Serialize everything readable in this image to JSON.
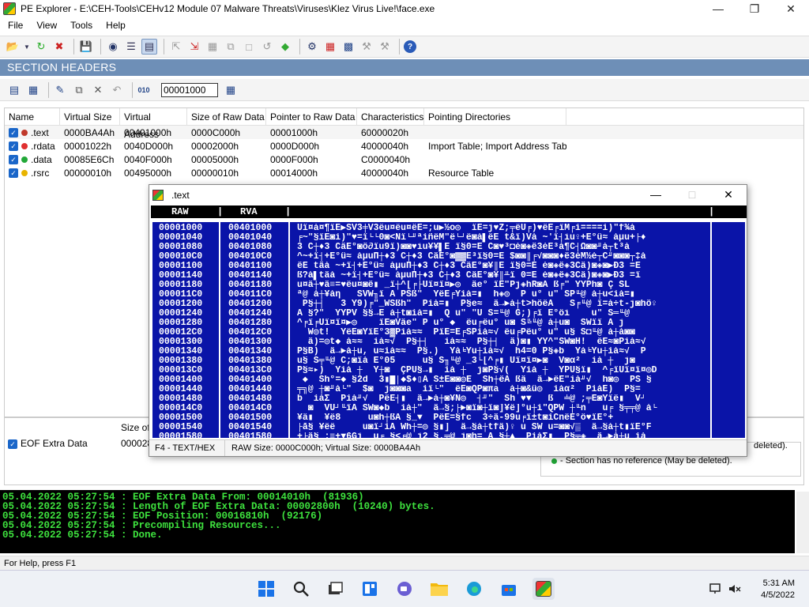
{
  "window": {
    "title": "PE Explorer - E:\\CEH-Tools\\CEHv12 Module 07 Malware Threats\\Viruses\\Klez Virus Live!\\face.exe"
  },
  "menu": [
    "File",
    "View",
    "Tools",
    "Help"
  ],
  "section_title": "SECTION HEADERS",
  "address_input": "00001000",
  "table": {
    "headers": [
      "Name",
      "Virtual Size",
      "Virtual Address",
      "Size of Raw Data",
      "Pointer to Raw Data",
      "Characteristics",
      "Pointing Directories"
    ],
    "rows": [
      {
        "name": ".text",
        "dot": "#c0392b",
        "vsize": "0000BA4Ah",
        "vaddr": "00401000h",
        "rawsize": "0000C000h",
        "rawptr": "00001000h",
        "chars": "60000020h",
        "dirs": ""
      },
      {
        "name": ".rdata",
        "dot": "#e03030",
        "vsize": "00001022h",
        "vaddr": "0040D000h",
        "rawsize": "00002000h",
        "rawptr": "0000D000h",
        "chars": "40000040h",
        "dirs": "Import Table; Import Address Table"
      },
      {
        "name": ".data",
        "dot": "#22a838",
        "vsize": "00085E6Ch",
        "vaddr": "0040F000h",
        "rawsize": "00005000h",
        "rawptr": "0000F000h",
        "chars": "C0000040h",
        "dirs": ""
      },
      {
        "name": ".rsrc",
        "dot": "#e8b400",
        "vsize": "00000010h",
        "vaddr": "00495000h",
        "rawsize": "00000010h",
        "rawptr": "00014000h",
        "chars": "40000040h",
        "dirs": "Resource Table"
      }
    ]
  },
  "eof": {
    "label": "EOF Extra Data",
    "size_header": "Size of",
    "size_value": "000028",
    "note_deleted": "deleted).",
    "note_no_ref": "- Section has no reference (May be deleted)."
  },
  "log": [
    "05.04.2022 05:27:54 : EOF Extra Data From: 00014010h  (81936)",
    "05.04.2022 05:27:54 : Length of EOF Extra Data: 00002800h  (10240) bytes.",
    "05.04.2022 05:27:54 : EOF Position: 00016810h  (92176)",
    "05.04.2022 05:27:54 : Precompiling Resources...",
    "05.04.2022 05:27:54 : Done."
  ],
  "status": "For Help, press F1",
  "hex_window": {
    "title": ".text",
    "col_raw": "RAW",
    "col_rva": "RVA",
    "status_mode": "F4 - TEXT/HEX",
    "status_info": "RAW Size: 0000C000h;  Virtual Size: 0000BA4Ah",
    "rows": [
      {
        "raw": "00001000",
        "rva": "00401000",
        "txt": "Uï¤à¤¶ïE▶SV3╪V3ëu¤ëu¤ëE=;u▶½o◎  ïE=j♥Z;╤ëU╒)♥ëE╒ïM╒ì====ì)\"f¾à"
      },
      {
        "raw": "00001040",
        "rva": "00401040",
        "txt": "╒~\"§ïE◙ì)\"♥=ï└└0◙<Ñï└╜ªìñëM\"ë└┘ë◙à▌ëE t&ï)Vá ~'ï┤iu♀+E°ü≈ àµu+├♦"
      },
      {
        "raw": "00001080",
        "rva": "00401080",
        "txt": "3 C┼♦3 CâE°◙ô∂ïu9ï)◙◙♥iu¥¥▌E ï§0=E C◙♥³◘è◙◈ê3èE³à¶C┤Ω◙◙╜à┬t³à"
      },
      {
        "raw": "000010C0",
        "rva": "004010C0",
        "txt": "^~+ï┤+E°ü≈ àµuΠ┼♦3 C┼♦3 CâE°◙▓▓E³ï§0=E $◙◙║╒√◙◙◙♦ê3èM½è┬C╜◙◙◙┬‡à"
      },
      {
        "raw": "00001100",
        "rva": "00401100",
        "txt": "êE tâà ~+ï┤+E°ü≈ àµuΠ┼♦3 C┼♦3 CâE°◙¥║E ï§0=E è◙◈ê◈3Câ)◙◈◙▶Đ3 =E"
      },
      {
        "raw": "00001140",
        "rva": "00401140",
        "txt": "ß?à▌tâà ~+ï┤+E°ü≈ àµuΠ┼♦3 C┼♦3 CâE°◙¥║╨ï 0=E è◙◈ê◈3Câ)◙◈◙▶Đ3 =ï"
      },
      {
        "raw": "00001180",
        "rva": "00401180",
        "txt": "u¤â┼♥â≡=♥ëu¤◙ê▮ _ï┼^[╒├Uï¤ï¤▶◎  âe° ïE\"Pj◈hR◙A ß╒\" YYPh◙ Ç SL"
      },
      {
        "raw": "000011C0",
        "rva": "004011C0",
        "txt": "ª@ à┼¥àη   SVW╖ï A PSß\"  YëE╒Yìà=▮  h◈◎  P u° u\" SP╙@ à┼u<ìà=▮"
      },
      {
        "raw": "00001200",
        "rva": "00401200",
        "txt": " P§┼┤   3 Y9)╒\"_WSßh\"  Pìà=▮  P§e≈  â→►à┼t>hôëΑ   S╒╙@ ï=à÷t-j◙hô♀"
      },
      {
        "raw": "00001240",
        "rva": "00401240",
        "txt": "A §?\"  YYPV §§→E à┼t◙ìà=▮  Q u\" \"U S=╙@ G;)╒ï E°öi    u\" S═╙@"
      },
      {
        "raw": "00001280",
        "rva": "00401280",
        "txt": "^╒ï╒Uï¤ï¤▶◎    ïE◙Vâe\" P u° ◆  ëu╒ëu° u◙ S╚╙@ à┼u◙  SWïï A j"
      },
      {
        "raw": "000012C0",
        "rva": "004012C0",
        "txt": "  W◎t!  YëE◙YïE°3▓Pìà≈≈  PïE=Ε╒SPìà≈√ ëu╒Pëu° u\" u§ S◘╙@ à┼à◙◙"
      },
      {
        "raw": "00001300",
        "rva": "00401300",
        "txt": "  â)=◎t◆ à≈≈  ìà≈√  P§┼┤   ìà≈≈  P§┼┤  â)◙▮ YY^\"SW◙H!  ëE≈◙Pìà≈√"
      },
      {
        "raw": "00001340",
        "rva": "00401340",
        "txt": "P§B)  â→►à┼u, u≈ìà≈≈  P§.)  Yà╘Yu┼ìà≈√  h4=0 P§◈b  Yà╘Yu┼ìà≈√  P"
      },
      {
        "raw": "00001380",
        "rva": "00401380",
        "txt": "u§ S╤╙@ C;◙ïá E°05     u§ S╖╙@ _3└[^╒▮ Uï¤ï¤▶◙  V◙α²  ìà ┼  j◙"
      },
      {
        "raw": "000013C0",
        "rva": "004013C0",
        "txt": "P§≈▸)  Yìà ┼  Y┼◙  ÇPU§→▮  ìà ┼  j◙P§√(  Yìà ┼  YPU§ï▮  ^╒ïUï¤ï¤◎D"
      },
      {
        "raw": "00001400",
        "rva": "00401400",
        "txt": " ◆  Sh°=◆ §2d  3▮█│◆$♦▯A S±E◙◙◎E  Sh┼ëA ßâ  â→►ëE\"ìà╜√  h◙◎  PS §"
      },
      {
        "raw": "00001440",
        "rva": "00401440",
        "txt": "╤╗@ ┼◙╜à└\"  $◙  j◙◙◙a  ìï└\"  ëE◙QP◙πa  à┼◙&ü◎  ìàα²  PìàE)  P§="
      },
      {
        "raw": "00001480",
        "rva": "00401480",
        "txt": "b  ìàΣ  Pìà╜√  PëE┤▮  â→►à┼◙¥N◎  ┤╜\"  Sh ♥▼   ß  ╧@ ;╤E◙Yïë▮  V┘"
      },
      {
        "raw": "000014C0",
        "rva": "004014C0",
        "txt": "  ◙  VU┘╙ïA SW◙◆b  ìà┼\"  â→§;├►◙ï◙┼ï◙]¥ë]°u┼ì\"QPW ┼╙n   u╒ §╤╤@ à└"
      },
      {
        "raw": "00001500",
        "rva": "00401500",
        "txt": "¥ä▮  ¥ë8     u◙h┼ßA §_▼  PëE=§fc  3÷â-99u╒ï±t◙ìCnëE°ö♥ïE°+"
      },
      {
        "raw": "00001540",
        "rva": "00401540",
        "txt": "├ā§ ¥ëë     u◙ï┘ìA Wh┼=◎ §▮]  â→§à┼tfâ)♀ u SW u=◙◙√▒  â→§à┼t▮ïE°F"
      },
      {
        "raw": "00001580",
        "rva": "00401580",
        "txt": "+├â§ ;≡+▼6Gj  u╒ §<╒@ j2 §.╤@ j◙h= A §┼▲  PìàΣ▮  P§╤◈  â→►à┼u ìà"
      }
    ]
  },
  "tray": {
    "time": "5:31 AM",
    "date": "4/5/2022"
  }
}
